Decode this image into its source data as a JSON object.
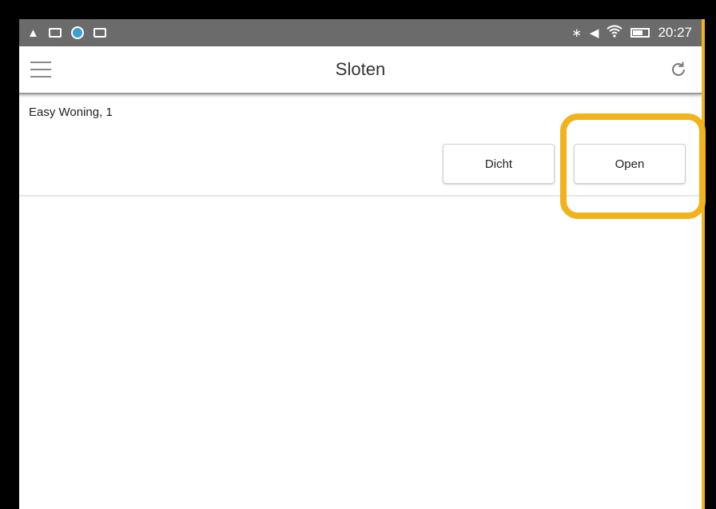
{
  "status_bar": {
    "time": "20:27",
    "left_icons": [
      "warning-icon",
      "picture-icon",
      "browser-icon",
      "mail-icon"
    ],
    "right_icons": [
      "bluetooth-icon",
      "volume-icon",
      "wifi-icon",
      "battery-icon"
    ]
  },
  "app_bar": {
    "title": "Sloten",
    "menu_icon": "hamburger-menu-icon",
    "refresh_icon": "refresh-icon"
  },
  "locks": [
    {
      "name": "Easy Woning, 1",
      "close_label": "Dicht",
      "open_label": "Open"
    }
  ],
  "colors": {
    "highlight": "#f2b21b",
    "status_bar": "#6b6b6b"
  }
}
